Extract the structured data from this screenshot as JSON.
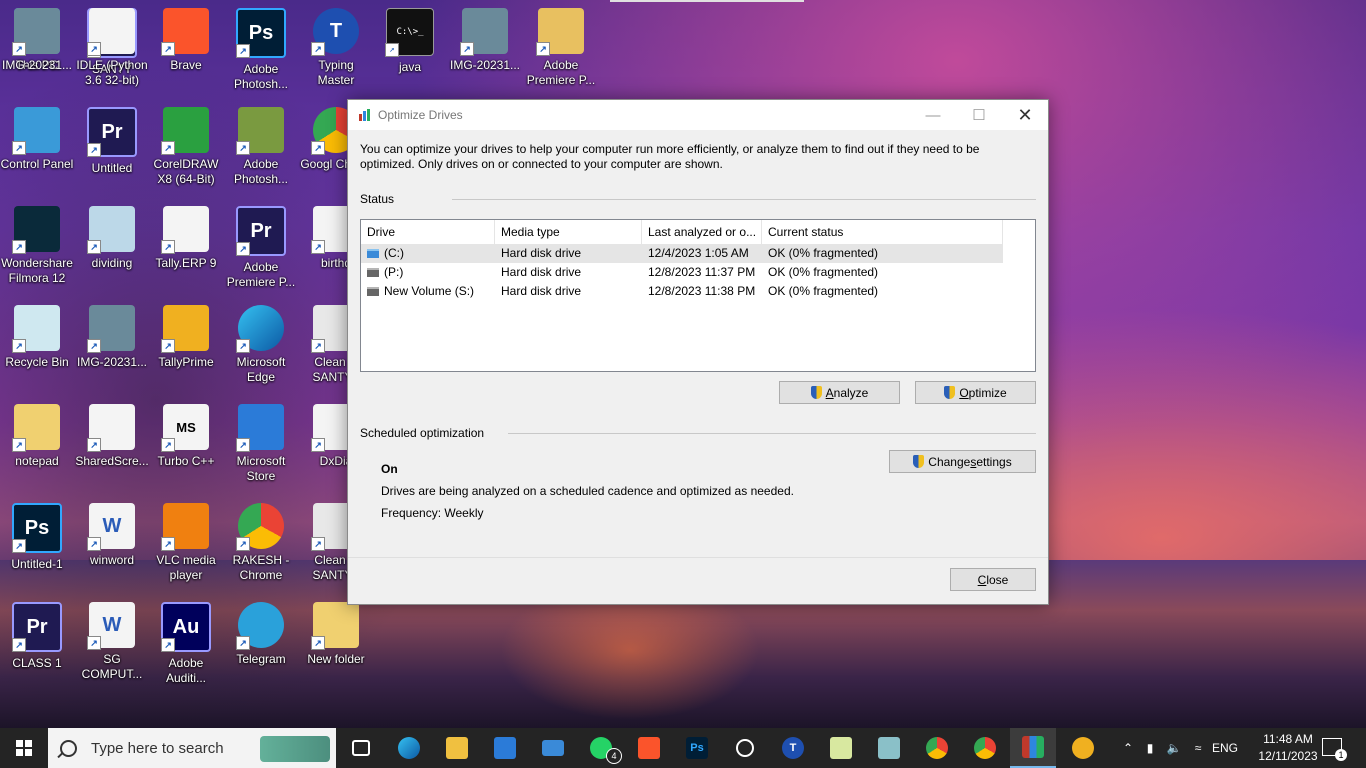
{
  "desktop_icons": [
    {
      "label": "This PC",
      "glyph": "",
      "kind": "pc"
    },
    {
      "label": "SANTY",
      "glyph": "Pr",
      "kind": "pr"
    },
    {
      "label": "Brave",
      "glyph": "",
      "kind": "brave"
    },
    {
      "label": "Adobe Photosh...",
      "glyph": "Ps",
      "kind": "ps"
    },
    {
      "label": "Typing Master",
      "glyph": "T",
      "kind": "typing"
    },
    {
      "label": "java",
      "glyph": "C:\\>_",
      "kind": "cmd"
    },
    {
      "label": "IMG-20231...",
      "glyph": "",
      "kind": "photo"
    },
    {
      "label": "Adobe Premiere P...",
      "glyph": "",
      "kind": "folderpr"
    },
    {
      "label": "Control Panel",
      "glyph": "",
      "kind": "control"
    },
    {
      "label": "Untitled",
      "glyph": "Pr",
      "kind": "pr"
    },
    {
      "label": "CorelDRAW X8 (64-Bit)",
      "glyph": "",
      "kind": "corel"
    },
    {
      "label": "Adobe Photosh...",
      "glyph": "",
      "kind": "photoshop-old"
    },
    {
      "label": "Googl Chrom",
      "glyph": "",
      "kind": "chrome"
    },
    {
      "label": "Wondershare Filmora 12",
      "glyph": "",
      "kind": "filmora"
    },
    {
      "label": "dividing",
      "glyph": "",
      "kind": "notepad"
    },
    {
      "label": "Tally.ERP 9",
      "glyph": "",
      "kind": "tally"
    },
    {
      "label": "Adobe Premiere P...",
      "glyph": "Pr",
      "kind": "pr"
    },
    {
      "label": "birthd",
      "glyph": "",
      "kind": "doc"
    },
    {
      "label": "Recycle Bin",
      "glyph": "",
      "kind": "recycle"
    },
    {
      "label": "IMG-20231...",
      "glyph": "",
      "kind": "photo"
    },
    {
      "label": "TallyPrime",
      "glyph": "",
      "kind": "tallyprime"
    },
    {
      "label": "Microsoft Edge",
      "glyph": "",
      "kind": "edge"
    },
    {
      "label": "Clean U SANTY (",
      "glyph": "",
      "kind": "gear"
    },
    {
      "label": "notepad",
      "glyph": "",
      "kind": "folder"
    },
    {
      "label": "SharedScre...",
      "glyph": "",
      "kind": "doc"
    },
    {
      "label": "Turbo C++",
      "glyph": "MS",
      "kind": "turbo"
    },
    {
      "label": "Microsoft Store",
      "glyph": "",
      "kind": "store"
    },
    {
      "label": "DxDia",
      "glyph": "",
      "kind": "doc"
    },
    {
      "label": "Untitled-1",
      "glyph": "Ps",
      "kind": "ps"
    },
    {
      "label": "winword",
      "glyph": "W",
      "kind": "word"
    },
    {
      "label": "VLC media player",
      "glyph": "",
      "kind": "vlc"
    },
    {
      "label": "RAKESH - Chrome",
      "glyph": "",
      "kind": "chrome"
    },
    {
      "label": "Clean U SANTY (",
      "glyph": "",
      "kind": "gear"
    },
    {
      "label": "CLASS 1",
      "glyph": "Pr",
      "kind": "pr"
    },
    {
      "label": "SG COMPUT...",
      "glyph": "W",
      "kind": "word"
    },
    {
      "label": "Adobe Auditi...",
      "glyph": "Au",
      "kind": "au"
    },
    {
      "label": "Telegram",
      "glyph": "",
      "kind": "telegram"
    },
    {
      "label": "New folder",
      "glyph": "",
      "kind": "folder"
    },
    {
      "label": "IMG-20231...",
      "glyph": "",
      "kind": "photo"
    },
    {
      "label": "IDLE (Python 3.6 32-bit)",
      "glyph": "",
      "kind": "python"
    }
  ],
  "window": {
    "title": "Optimize Drives",
    "intro": "You can optimize your drives to help your computer run more efficiently, or analyze them to find out if they need to be optimized. Only drives on or connected to your computer are shown.",
    "status_label": "Status",
    "columns": [
      "Drive",
      "Media type",
      "Last analyzed or o...",
      "Current status"
    ],
    "drives": [
      {
        "drive": "(C:)",
        "media": "Hard disk drive",
        "last": "12/4/2023 1:05 AM",
        "status": "OK (0% fragmented)",
        "icon": "windows-drive-icon"
      },
      {
        "drive": "(P:)",
        "media": "Hard disk drive",
        "last": "12/8/2023 11:37 PM",
        "status": "OK (0% fragmented)",
        "icon": "drive-icon"
      },
      {
        "drive": "New Volume (S:)",
        "media": "Hard disk drive",
        "last": "12/8/2023 11:38 PM",
        "status": "OK (0% fragmented)",
        "icon": "drive-icon"
      }
    ],
    "analyze_first": "A",
    "analyze_rest": "nalyze",
    "optimize_first": "O",
    "optimize_rest": "ptimize",
    "scheduled_label": "Scheduled optimization",
    "sched_state": "On",
    "sched_desc": "Drives are being analyzed on a scheduled cadence and optimized as needed.",
    "sched_freq": "Frequency: Weekly",
    "change_first": "Change ",
    "change_mid": "s",
    "change_rest": "ettings",
    "close_first": "C",
    "close_rest": "lose"
  },
  "taskbar": {
    "search_placeholder": "Type here to search",
    "whatsapp_badge": "4",
    "language": "ENG",
    "time": "11:48 AM",
    "date": "12/11/2023",
    "notification_count": "1"
  },
  "colors": {
    "taskbar_bg": "#242424",
    "accent": "#76b9ed",
    "window_bg": "#f0f0f0"
  }
}
